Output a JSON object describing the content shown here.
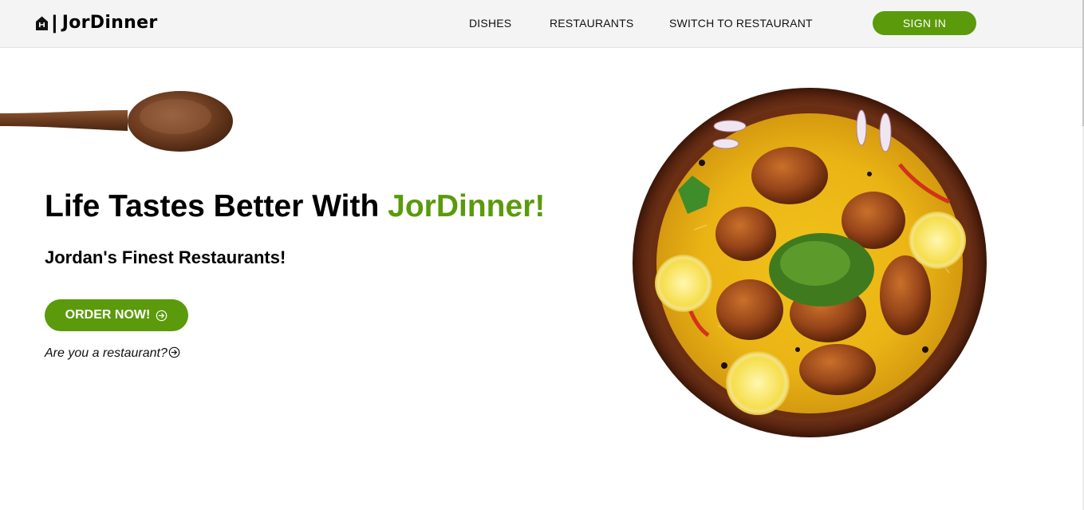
{
  "header": {
    "brand_separator": "|",
    "brand_name": "JorDinner",
    "brand_icon": "home-icon",
    "nav": [
      {
        "label": "DISHES"
      },
      {
        "label": "RESTAURANTS"
      },
      {
        "label": "SWITCH TO RESTAURANT"
      }
    ],
    "signin_label": "SIGN IN"
  },
  "hero": {
    "headline_prefix": "Life Tastes Better With ",
    "headline_accent": "JorDinner!",
    "subheadline": "Jordan's Finest Restaurants!",
    "order_button_label": "ORDER NOW!",
    "restaurant_link_label": "Are you a restaurant?",
    "decor_image": "wooden-spoon",
    "hero_image": "biryani-chicken-plate"
  },
  "colors": {
    "accent": "#5a9a0b",
    "header_bg": "#f4f4f4",
    "text": "#000000"
  }
}
